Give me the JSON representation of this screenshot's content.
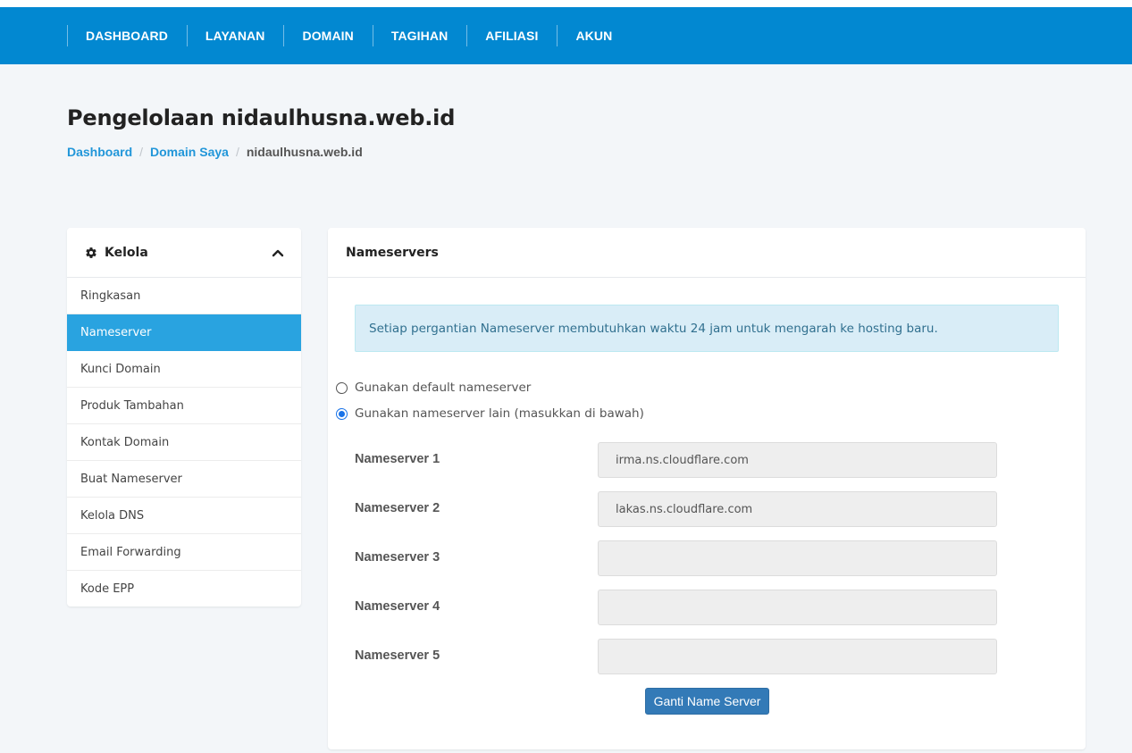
{
  "nav": {
    "items": [
      {
        "label": "DASHBOARD"
      },
      {
        "label": "LAYANAN"
      },
      {
        "label": "DOMAIN"
      },
      {
        "label": "TAGIHAN"
      },
      {
        "label": "AFILIASI"
      },
      {
        "label": "AKUN"
      }
    ]
  },
  "page": {
    "title": "Pengelolaan nidaulhusna.web.id",
    "breadcrumb": [
      {
        "label": "Dashboard"
      },
      {
        "label": "Domain Saya"
      },
      {
        "label": "nidaulhusna.web.id"
      }
    ]
  },
  "sidebar": {
    "title": "Kelola",
    "icon": "gear-icon",
    "collapse_icon": "chevron-up-icon",
    "items": [
      {
        "label": "Ringkasan"
      },
      {
        "label": "Nameserver"
      },
      {
        "label": "Kunci Domain"
      },
      {
        "label": "Produk Tambahan"
      },
      {
        "label": "Kontak Domain"
      },
      {
        "label": "Buat Nameserver"
      },
      {
        "label": "Kelola DNS"
      },
      {
        "label": "Email Forwarding"
      },
      {
        "label": "Kode EPP"
      }
    ],
    "active_item": "Nameserver"
  },
  "main": {
    "title": "Nameservers",
    "alert": "Setiap pergantian Nameserver membutuhkan waktu 24 jam untuk mengarah ke hosting baru.",
    "options": [
      {
        "label": "Gunakan default nameserver",
        "checked": false
      },
      {
        "label": "Gunakan nameserver lain (masukkan di bawah)",
        "checked": true
      }
    ],
    "nameservers": [
      {
        "label": "Nameserver 1",
        "value": "irma.ns.cloudflare.com"
      },
      {
        "label": "Nameserver 2",
        "value": "lakas.ns.cloudflare.com"
      },
      {
        "label": "Nameserver 3",
        "value": ""
      },
      {
        "label": "Nameserver 4",
        "value": ""
      },
      {
        "label": "Nameserver 5",
        "value": ""
      }
    ],
    "submit_label": "Ganti Name Server"
  },
  "colors": {
    "navbar": "#0288d1",
    "active_sidebar": "#29a3e0",
    "button": "#337ab7",
    "link": "#2196d9",
    "alert_bg": "#d9edf7"
  }
}
